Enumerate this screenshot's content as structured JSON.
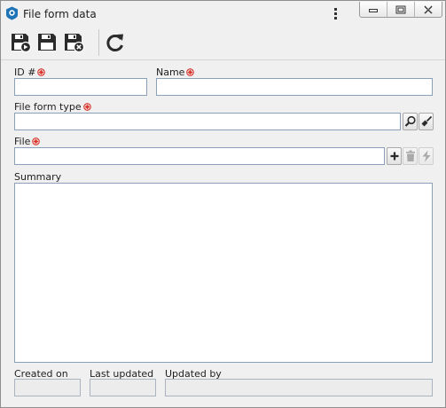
{
  "window": {
    "title": "File form data"
  },
  "toolbar": {
    "buttons": [
      "save-and-new",
      "save",
      "save-and-close",
      "refresh"
    ]
  },
  "form": {
    "id_label": "ID #",
    "id_value": "",
    "name_label": "Name",
    "name_value": "",
    "type_label": "File form type",
    "type_value": "",
    "file_label": "File",
    "file_value": "",
    "summary_label": "Summary",
    "summary_value": "",
    "created_label": "Created on",
    "created_value": "",
    "updated_label": "Last updated",
    "updated_value": "",
    "updated_by_label": "Updated by",
    "updated_by_value": ""
  },
  "colors": {
    "required": "#d9342b",
    "field_border": "#8aa0b8",
    "window_bg": "#f0f0f0"
  }
}
